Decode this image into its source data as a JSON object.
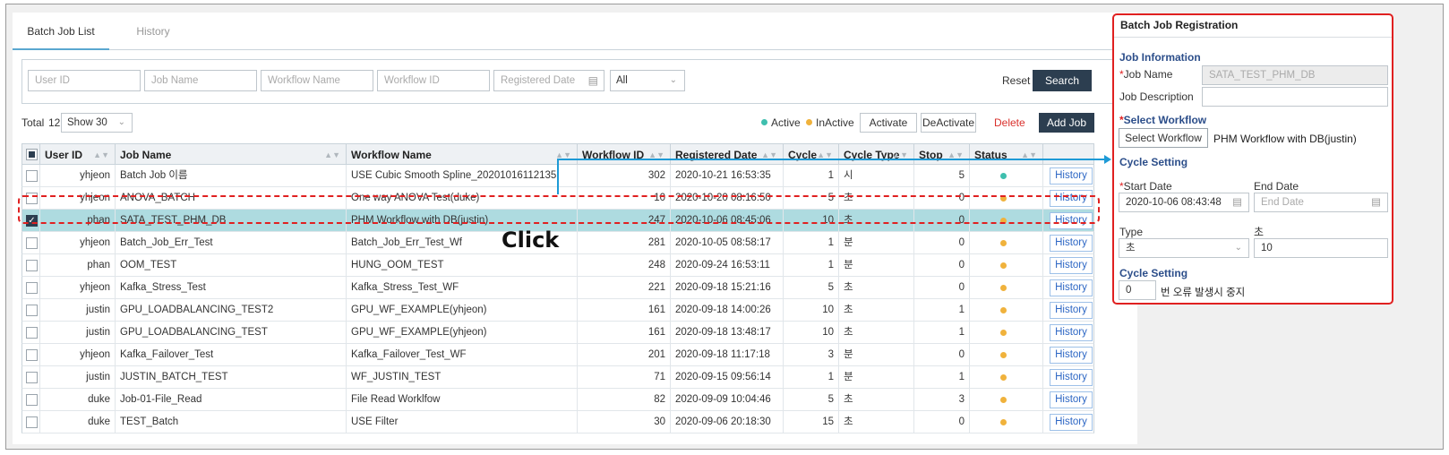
{
  "tabs": [
    {
      "label": "Batch Job List",
      "active": true
    },
    {
      "label": "History",
      "active": false
    }
  ],
  "filters": {
    "user_id": "User ID",
    "job_name": "Job Name",
    "workflow_name": "Workflow Name",
    "workflow_id": "Workflow ID",
    "registered_date": "Registered Date",
    "status_select": "All",
    "reset_label": "Reset",
    "search_label": "Search"
  },
  "toolbar": {
    "total_label": "Total",
    "total_count": "12",
    "show_select": "Show 30",
    "legend_active": "Active",
    "legend_inactive": "InActive",
    "activate_label": "Activate",
    "deactivate_label": "DeActivate",
    "delete_label": "Delete",
    "add_job_label": "Add Job"
  },
  "colors": {
    "active": "#3fbfae",
    "inactive": "#f0b23c",
    "accent_dark": "#2c3e50",
    "highlight_red": "#e02020",
    "selected_row": "#aedbe0"
  },
  "table": {
    "headers": [
      "User ID",
      "Job Name",
      "Workflow Name",
      "Workflow ID",
      "Registered Date",
      "Cycle",
      "Cycle Type",
      "Stop",
      "Status"
    ],
    "history_label": "History",
    "rows": [
      {
        "user": "yhjeon",
        "job": "Batch Job 이름",
        "workflow": "USE Cubic Smooth Spline_20201016112135",
        "wid": "302",
        "date": "2020-10-21 16:53:35",
        "cycle": "1",
        "ctype": "시",
        "stop": "5",
        "status": "active",
        "checked": false
      },
      {
        "user": "yhjeon",
        "job": "ANOVA_BATCH",
        "workflow": "One way ANOVA Test(duke)",
        "wid": "10",
        "date": "2020-10-20 08:16:50",
        "cycle": "5",
        "ctype": "초",
        "stop": "0",
        "status": "inactive",
        "checked": false
      },
      {
        "user": "phan",
        "job": "SATA_TEST_PHM_DB",
        "workflow": "PHM Workflow with DB(justin)",
        "wid": "247",
        "date": "2020-10-06 08:45:06",
        "cycle": "10",
        "ctype": "초",
        "stop": "0",
        "status": "inactive",
        "checked": true
      },
      {
        "user": "yhjeon",
        "job": "Batch_Job_Err_Test",
        "workflow": "Batch_Job_Err_Test_Wf",
        "wid": "281",
        "date": "2020-10-05 08:58:17",
        "cycle": "1",
        "ctype": "분",
        "stop": "0",
        "status": "inactive",
        "checked": false
      },
      {
        "user": "phan",
        "job": "OOM_TEST",
        "workflow": "HUNG_OOM_TEST",
        "wid": "248",
        "date": "2020-09-24 16:53:11",
        "cycle": "1",
        "ctype": "분",
        "stop": "0",
        "status": "inactive",
        "checked": false
      },
      {
        "user": "yhjeon",
        "job": "Kafka_Stress_Test",
        "workflow": "Kafka_Stress_Test_WF",
        "wid": "221",
        "date": "2020-09-18 15:21:16",
        "cycle": "5",
        "ctype": "초",
        "stop": "0",
        "status": "inactive",
        "checked": false
      },
      {
        "user": "justin",
        "job": "GPU_LOADBALANCING_TEST2",
        "workflow": "GPU_WF_EXAMPLE(yhjeon)",
        "wid": "161",
        "date": "2020-09-18 14:00:26",
        "cycle": "10",
        "ctype": "초",
        "stop": "1",
        "status": "inactive",
        "checked": false
      },
      {
        "user": "justin",
        "job": "GPU_LOADBALANCING_TEST",
        "workflow": "GPU_WF_EXAMPLE(yhjeon)",
        "wid": "161",
        "date": "2020-09-18 13:48:17",
        "cycle": "10",
        "ctype": "초",
        "stop": "1",
        "status": "inactive",
        "checked": false
      },
      {
        "user": "yhjeon",
        "job": "Kafka_Failover_Test",
        "workflow": "Kafka_Failover_Test_WF",
        "wid": "201",
        "date": "2020-09-18 11:17:18",
        "cycle": "3",
        "ctype": "분",
        "stop": "0",
        "status": "inactive",
        "checked": false
      },
      {
        "user": "justin",
        "job": "JUSTIN_BATCH_TEST",
        "workflow": "WF_JUSTIN_TEST",
        "wid": "71",
        "date": "2020-09-15 09:56:14",
        "cycle": "1",
        "ctype": "분",
        "stop": "1",
        "status": "inactive",
        "checked": false
      },
      {
        "user": "duke",
        "job": "Job-01-File_Read",
        "workflow": "File Read Worklfow",
        "wid": "82",
        "date": "2020-09-09 10:04:46",
        "cycle": "5",
        "ctype": "초",
        "stop": "3",
        "status": "inactive",
        "checked": false
      },
      {
        "user": "duke",
        "job": "TEST_Batch",
        "workflow": "USE Filter",
        "wid": "30",
        "date": "2020-09-06 20:18:30",
        "cycle": "15",
        "ctype": "초",
        "stop": "0",
        "status": "inactive",
        "checked": false
      }
    ]
  },
  "annotation": {
    "click_label": "Click"
  },
  "registration": {
    "title": "Batch Job Registration",
    "job_info_title": "Job Information",
    "job_name_label": "Job Name",
    "job_name_value": "SATA_TEST_PHM_DB",
    "job_desc_label": "Job Description",
    "job_desc_value": "",
    "select_workflow_title": "Select Workflow",
    "select_workflow_button": "Select Workflow",
    "selected_workflow": "PHM Workflow with DB(justin)",
    "cycle_setting_title": "Cycle Setting",
    "start_date_label": "Start Date",
    "start_date_value": "2020-10-06 08:43:48",
    "end_date_label": "End Date",
    "end_date_placeholder": "End Date",
    "type_label": "Type",
    "type_value": "초",
    "unit_label": "초",
    "unit_value": "10",
    "cycle_setting2_title": "Cycle Setting",
    "stop_count_value": "0",
    "stop_text": "번 오류 발생시 중지"
  }
}
